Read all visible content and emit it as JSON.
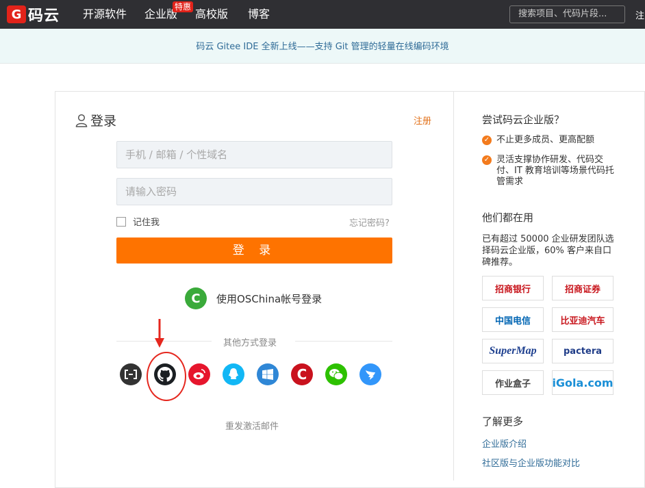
{
  "header": {
    "logo_glyph": "G",
    "logo_text": "码云",
    "nav": [
      "开源软件",
      "企业版",
      "高校版",
      "博客"
    ],
    "hot_badge": "特惠",
    "search_placeholder": "搜索项目、代码片段...",
    "search_tail": "注"
  },
  "banner": {
    "text": "码云 Gitee IDE 全新上线——支持 Git 管理的轻量在线编码环境"
  },
  "login": {
    "title": "登录",
    "register_link": "注册",
    "account_placeholder": "手机 / 邮箱 / 个性域名",
    "password_placeholder": "请输入密码",
    "remember_label": "记住我",
    "forgot_link": "忘记密码?",
    "submit_label": "登 录",
    "oschina_label": "使用OSChina帐号登录",
    "oschina_glyph": "C",
    "other_methods": "其他方式登录",
    "resend_email": "重发激活邮件"
  },
  "social": [
    {
      "name": "aliyun",
      "color": "#333333",
      "glyph": "[-]"
    },
    {
      "name": "github",
      "color": "#1b1f23",
      "glyph": ""
    },
    {
      "name": "weibo",
      "color": "#e6162d",
      "glyph": ""
    },
    {
      "name": "qq",
      "color": "#12b7f5",
      "glyph": ""
    },
    {
      "name": "windows",
      "color": "#2f87d6",
      "glyph": ""
    },
    {
      "name": "csdn",
      "color": "#c9121e",
      "glyph": "C"
    },
    {
      "name": "wechat",
      "color": "#2dc100",
      "glyph": ""
    },
    {
      "name": "dingtalk",
      "color": "#3296fa",
      "glyph": ""
    }
  ],
  "sidebar": {
    "try_title": "尝试码云企业版？",
    "benefit_1": "不止更多成员、更高配额",
    "benefit_2": "灵活支撑协作研发、代码交付、IT 教育培训等场景代码托管需求",
    "users_title": "他们都在用",
    "users_text": "已有超过 50000 企业研发团队选择码云企业版，60% 客户来自口碑推荐。",
    "logos": [
      "招商银行",
      "招商证券",
      "中国电信",
      "比亚迪汽车",
      "SuperMap",
      "pactera",
      "作业盒子",
      "iGola.com"
    ],
    "more_title": "了解更多",
    "link_1": "企业版介绍",
    "link_2": "社区版与企业版功能对比"
  },
  "colors": {
    "accent": "#fe7300",
    "topbar": "#2f2f33",
    "link": "#2f6b97",
    "annotation": "#e5271e"
  }
}
